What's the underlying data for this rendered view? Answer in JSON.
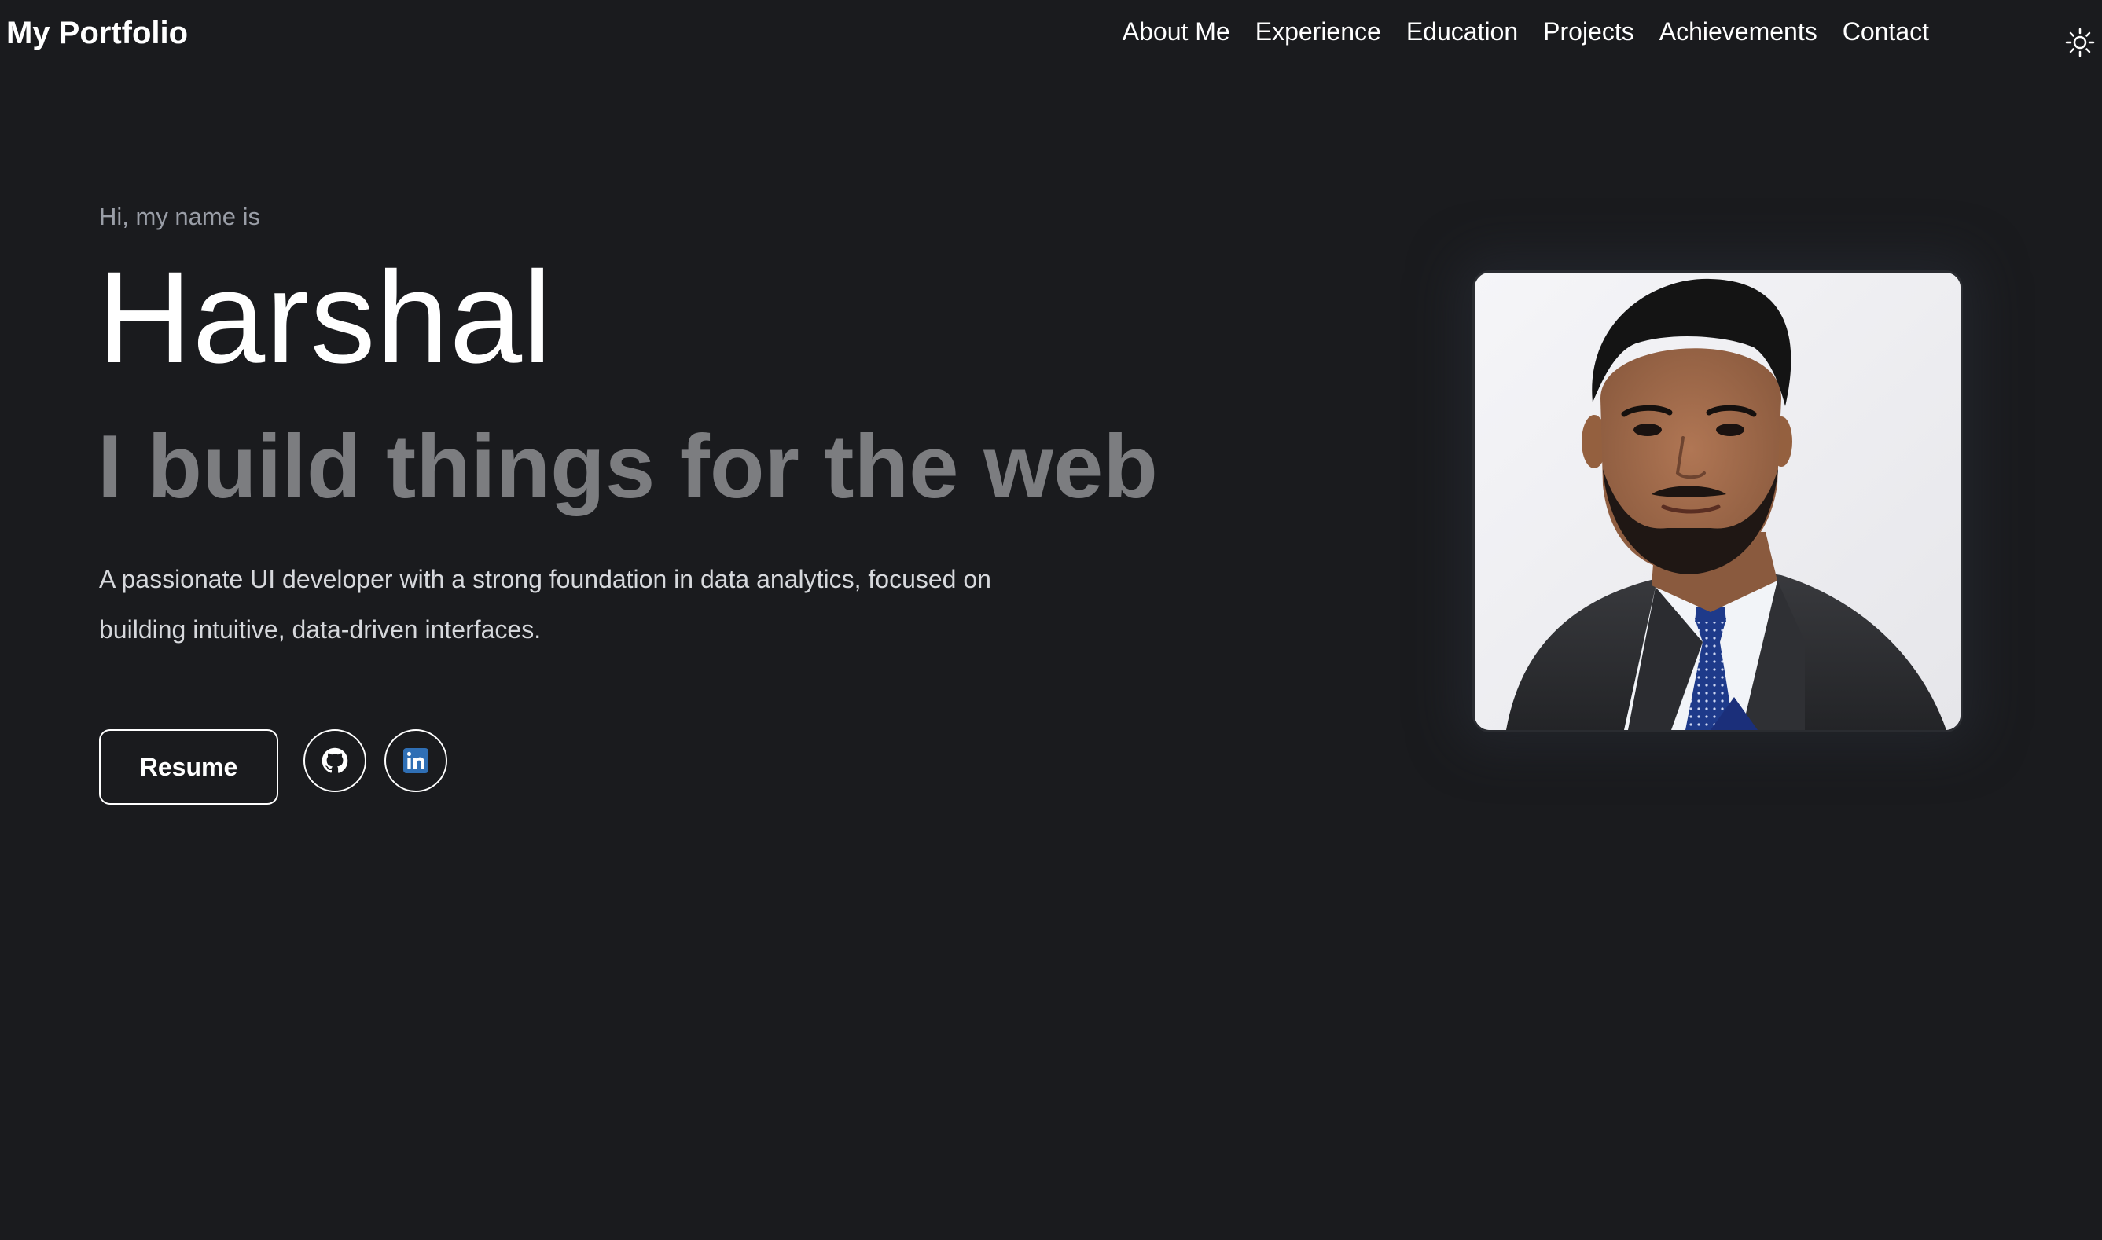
{
  "header": {
    "brand": "My Portfolio",
    "nav": [
      {
        "label": "About Me"
      },
      {
        "label": "Experience"
      },
      {
        "label": "Education"
      },
      {
        "label": "Projects"
      },
      {
        "label": "Achievements"
      },
      {
        "label": "Contact"
      }
    ],
    "theme_toggle_icon": "sun-icon"
  },
  "hero": {
    "intro": "Hi, my name is",
    "name": "Harshal",
    "tagline": "I build things for the web",
    "description": "A passionate UI developer with a strong foundation in data analytics, focused on building intuitive, data-driven interfaces.",
    "resume_label": "Resume",
    "social": [
      {
        "icon": "github-icon"
      },
      {
        "icon": "linkedin-icon"
      }
    ],
    "portrait_icon": "profile-photo"
  },
  "colors": {
    "background": "#1a1b1e",
    "text": "#ffffff",
    "muted": "#7c7d80",
    "linkedin": "#2f6fb5"
  }
}
